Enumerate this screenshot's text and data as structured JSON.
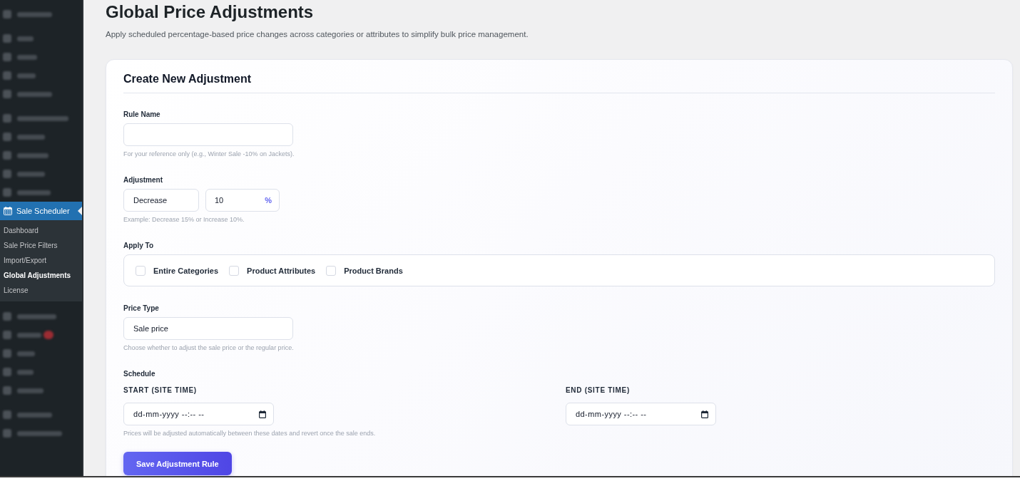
{
  "sidebar": {
    "groups": [
      [
        {
          "kind": "blurred",
          "badge": false
        }
      ],
      [
        {
          "kind": "blurred",
          "badge": false
        },
        {
          "kind": "blurred",
          "badge": false
        },
        {
          "kind": "blurred",
          "badge": false
        },
        {
          "kind": "blurred",
          "badge": false
        }
      ],
      [
        {
          "kind": "blurred",
          "badge": false
        },
        {
          "kind": "blurred",
          "badge": false
        },
        {
          "kind": "blurred",
          "badge": false
        },
        {
          "kind": "blurred",
          "badge": false
        },
        {
          "kind": "blurred",
          "badge": false
        },
        {
          "kind": "menu",
          "label": "Sale Scheduler",
          "selected": true,
          "submenu": [
            {
              "label": "Dashboard",
              "selected": false
            },
            {
              "label": "Sale Price Filters",
              "selected": false
            },
            {
              "label": "Import/Export",
              "selected": false
            },
            {
              "label": "Global Adjustments",
              "selected": true
            },
            {
              "label": "License",
              "selected": false
            }
          ]
        }
      ],
      [
        {
          "kind": "blurred",
          "badge": false
        },
        {
          "kind": "blurred",
          "badge": true
        },
        {
          "kind": "blurred",
          "badge": false
        },
        {
          "kind": "blurred",
          "badge": false
        },
        {
          "kind": "blurred",
          "badge": false
        }
      ],
      [
        {
          "kind": "blurred",
          "badge": false
        },
        {
          "kind": "blurred",
          "badge": false
        }
      ]
    ]
  },
  "page": {
    "title": "Global Price Adjustments",
    "description": "Apply scheduled percentage-based price changes across categories or attributes to simplify bulk price management."
  },
  "form": {
    "heading": "Create New Adjustment",
    "rule_name": {
      "label": "Rule Name",
      "help": "For your reference only (e.g., Winter Sale -10% on Jackets)."
    },
    "adjustment": {
      "label": "Adjustment",
      "direction": "Decrease",
      "amount": "10",
      "unit": "%",
      "help": "Example: Decrease 15% or Increase 10%."
    },
    "apply_to": {
      "label": "Apply To",
      "options": [
        {
          "label": "Entire Categories",
          "checked": false
        },
        {
          "label": "Product Attributes",
          "checked": false
        },
        {
          "label": "Product Brands",
          "checked": false
        }
      ]
    },
    "price_type": {
      "label": "Price Type",
      "value": "Sale price",
      "help": "Choose whether to adjust the sale price or the regular price."
    },
    "schedule": {
      "label": "Schedule",
      "fields": [
        {
          "label": "START (SITE TIME)",
          "placeholder": "dd-mm-yyyy --:-- --"
        },
        {
          "label": "END (SITE TIME)",
          "placeholder": "dd-mm-yyyy --:-- --"
        }
      ],
      "help": "Prices will be adjusted automatically between these dates and revert once the sale ends."
    },
    "submit": "Save Adjustment Rule"
  }
}
